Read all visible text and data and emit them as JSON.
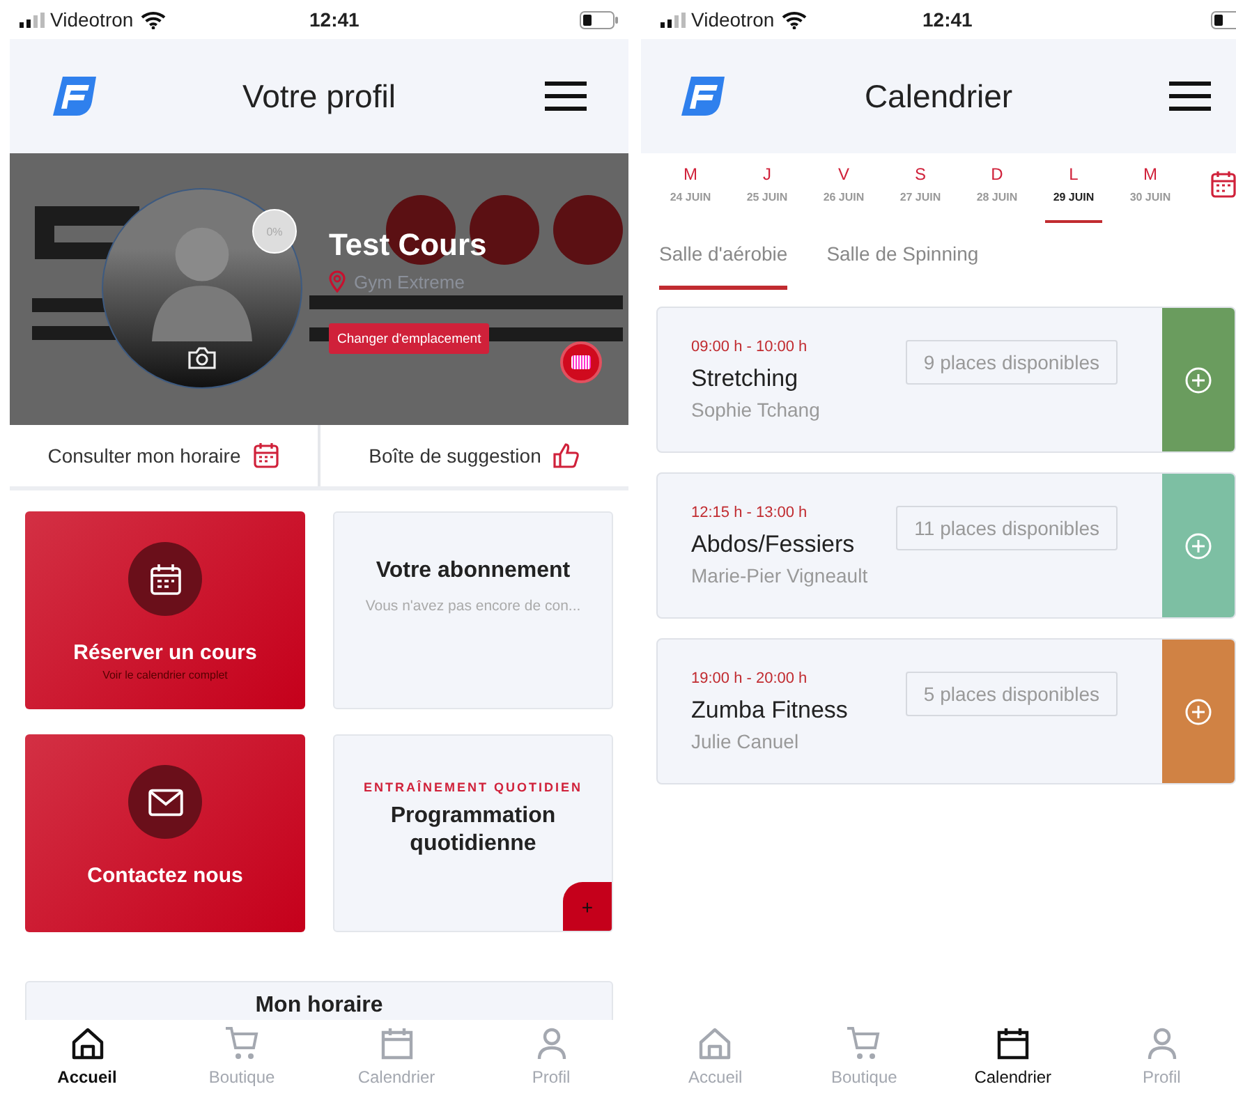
{
  "profile_screen": {
    "status_bar": {
      "carrier": "Videotron",
      "time": "12:41"
    },
    "header": {
      "title": "Votre profil"
    },
    "banner": {
      "progress": "0%",
      "name": "Test Cours",
      "location": "Gym Extreme",
      "change_button": "Changer d'emplacement"
    },
    "quick_links": [
      {
        "label": "Consulter mon horaire"
      },
      {
        "label": "Boîte de suggestion"
      }
    ],
    "tiles": [
      {
        "kind": "action",
        "title": "Réserver un cours",
        "subtitle": "Voir le calendrier complet"
      },
      {
        "kind": "info",
        "title": "Votre abonnement",
        "subtitle": "Vous n'avez pas encore de con..."
      },
      {
        "kind": "action",
        "title": "Contactez nous"
      },
      {
        "kind": "program",
        "eyebrow": "ENTRAÎNEMENT QUOTIDIEN",
        "title": "Programmation quotidienne",
        "button": "+"
      }
    ],
    "schedule_card": {
      "title": "Mon horaire"
    },
    "tab_bar": [
      {
        "label": "Accueil",
        "selected": true
      },
      {
        "label": "Boutique",
        "selected": false
      },
      {
        "label": "Calendrier",
        "selected": false
      },
      {
        "label": "Profil",
        "selected": false
      }
    ]
  },
  "calendar_screen": {
    "status_bar": {
      "carrier": "Videotron",
      "time": "12:41"
    },
    "header": {
      "title": "Calendrier"
    },
    "days": [
      {
        "day": "M",
        "date": "24 JUIN",
        "selected": false
      },
      {
        "day": "J",
        "date": "25 JUIN",
        "selected": false
      },
      {
        "day": "V",
        "date": "26 JUIN",
        "selected": false
      },
      {
        "day": "S",
        "date": "27 JUIN",
        "selected": false
      },
      {
        "day": "D",
        "date": "28 JUIN",
        "selected": false
      },
      {
        "day": "L",
        "date": "29 JUIN",
        "selected": true
      },
      {
        "day": "M",
        "date": "30 JUIN",
        "selected": false
      }
    ],
    "rooms": [
      {
        "label": "Salle d'aérobie",
        "selected": true
      },
      {
        "label": "Salle de Spinning",
        "selected": false
      }
    ],
    "classes": [
      {
        "time": "09:00 h - 10:00 h",
        "name": "Stretching",
        "instructor": "Sophie Tchang",
        "places": "9 places disponibles",
        "color": "#6a9c5e"
      },
      {
        "time": "12:15 h - 13:00 h",
        "name": "Abdos/Fessiers",
        "instructor": "Marie-Pier Vigneault",
        "places": "11 places disponibles",
        "color": "#7dbfa3"
      },
      {
        "time": "19:00 h - 20:00 h",
        "name": "Zumba Fitness",
        "instructor": "Julie Canuel",
        "places": "5 places disponibles",
        "color": "#d08244"
      }
    ],
    "tab_bar": [
      {
        "label": "Accueil",
        "selected": false
      },
      {
        "label": "Boutique",
        "selected": false
      },
      {
        "label": "Calendrier",
        "selected": true
      },
      {
        "label": "Profil",
        "selected": false
      }
    ]
  }
}
